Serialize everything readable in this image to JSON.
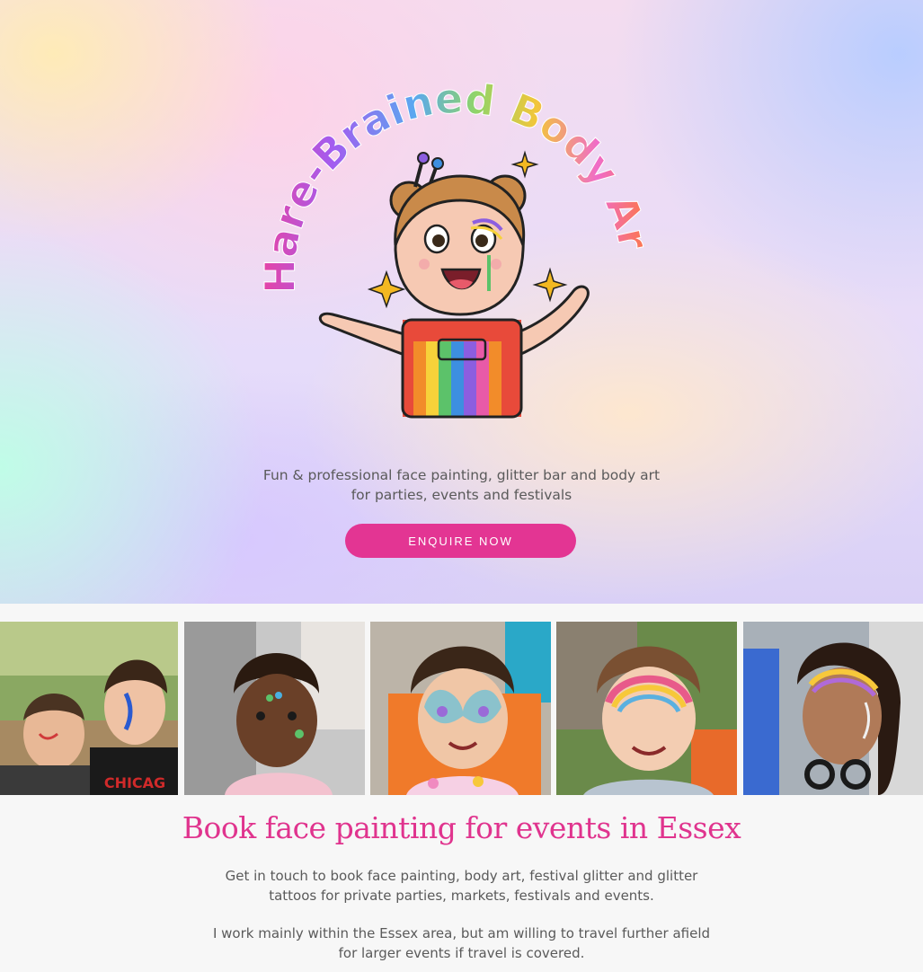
{
  "hero": {
    "logo_text": "Hare-Brained Body Art",
    "tagline_line1": "Fun & professional face painting, glitter bar and body art",
    "tagline_line2": "for parties, events and festivals",
    "cta_label": "ENQUIRE NOW"
  },
  "gallery": {
    "photos": [
      {
        "icon": "face-painted-boys-photo"
      },
      {
        "icon": "face-painted-girl-photo"
      },
      {
        "icon": "butterfly-face-paint-photo"
      },
      {
        "icon": "rainbow-face-paint-photo"
      },
      {
        "icon": "glitter-face-paint-photo"
      }
    ]
  },
  "intro": {
    "heading": "Book face painting for events in Essex",
    "para1_line1": "Get in touch to book face painting, body art, festival glitter and glitter",
    "para1_line2": "tattoos for private parties, markets, festivals and events.",
    "para2_line1": "I work mainly within the Essex area, but am willing to travel further afield",
    "para2_line2": "for larger events if travel is covered."
  },
  "colors": {
    "accent": "#e33593",
    "heading": "#e0348e",
    "text": "#5a5a5a",
    "background": "#f7f7f7"
  }
}
